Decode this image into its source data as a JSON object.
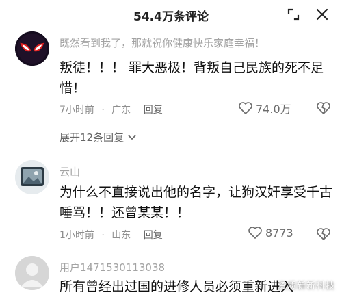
{
  "header": {
    "title": "54.4万条评论"
  },
  "comments": [
    {
      "username": "既然看到我了，那就祝你健康快乐家庭幸福！",
      "text": "叛徒！！！ 罪大恶极！背叛自己民族的死不足惜！",
      "time": "7小时前",
      "location": "广东",
      "reply_label": "回复",
      "likes": "74.0万",
      "expand_label": "展开12条回复"
    },
    {
      "username": "云山",
      "text": "为什么不直接说出他的名字，让狗汉奸享受千古唾骂！！还曾某某！！",
      "time": "1小时前",
      "location": "山东",
      "reply_label": "回复",
      "likes": "8773"
    },
    {
      "username": "用户1471530113038",
      "text": "所有曾经出过国的进修人员必须重新进入"
    }
  ],
  "watermark": "资质新新科技",
  "colors": {
    "accent_red": "#e02020",
    "meta_gray": "#8f8f8f"
  }
}
